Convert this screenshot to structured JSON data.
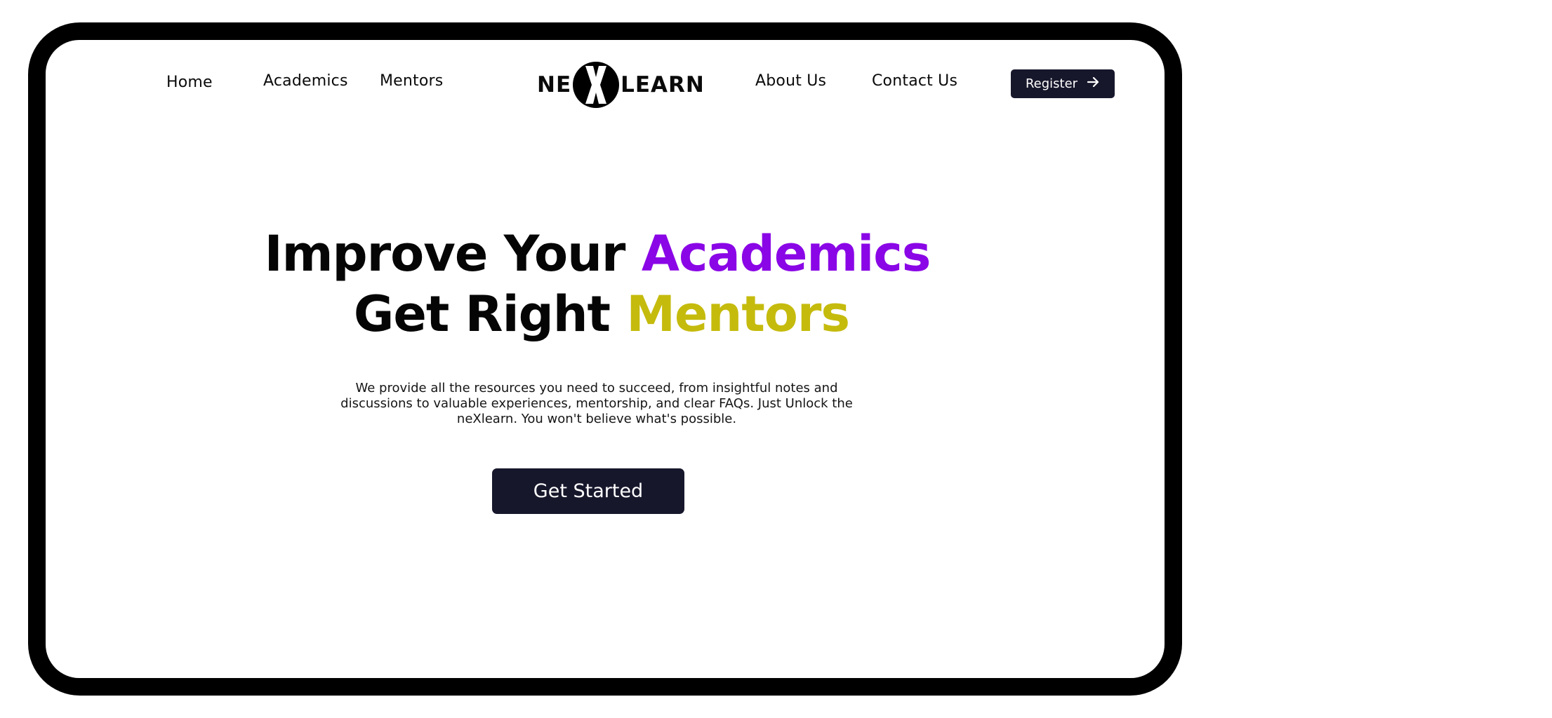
{
  "nav": {
    "left": [
      {
        "label": "Home"
      },
      {
        "label": "Academics"
      },
      {
        "label": "Mentors"
      }
    ],
    "right": [
      {
        "label": "About Us"
      },
      {
        "label": "Contact Us"
      }
    ],
    "register_label": "Register"
  },
  "logo": {
    "prefix": "NE",
    "suffix": "LEARN"
  },
  "hero": {
    "line1_text": "Improve Your ",
    "line1_accent": "Academics",
    "line2_text": "Get Right ",
    "line2_accent": "Mentors",
    "description": "We provide all the resources you need to succeed, from insightful notes and discussions to valuable experiences, mentorship, and clear FAQs. Just Unlock the neXlearn. You won't believe what's possible.",
    "cta_label": "Get Started"
  },
  "colors": {
    "accent_purple": "#8a06e6",
    "accent_olive": "#c5bb0d",
    "button_dark": "#17172c",
    "device_frame": "#000000"
  },
  "icons": {
    "register": "arrow-right-icon",
    "logo_mark": "x-circle-icon"
  }
}
